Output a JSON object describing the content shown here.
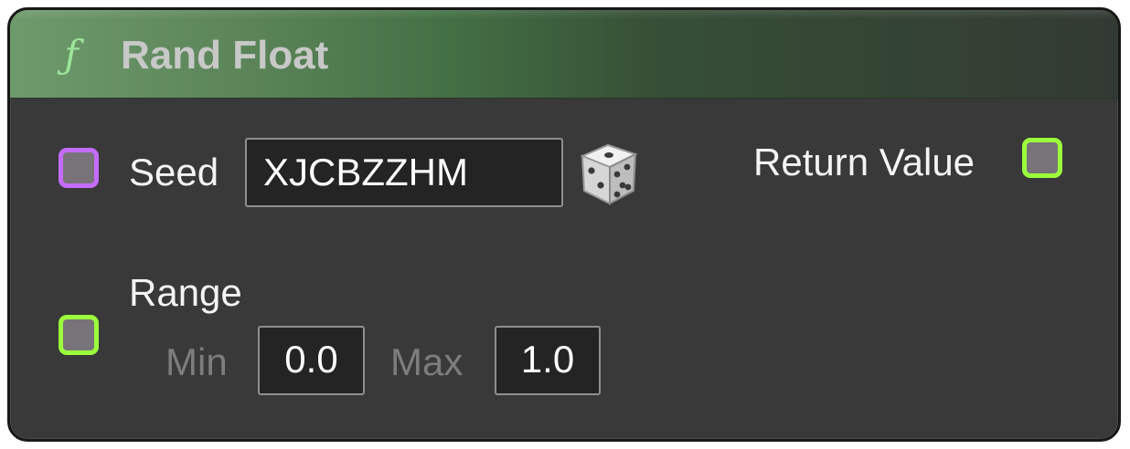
{
  "node": {
    "icon": "function-icon",
    "title": "Rand Float",
    "header_color": "#5a8458"
  },
  "inputs": {
    "seed": {
      "label": "Seed",
      "value": "XJCBZZHM",
      "pin_color": "#c46cff",
      "randomize_icon": "dice-icon"
    },
    "range": {
      "label": "Range",
      "min_label": "Min",
      "min_value": "0.0",
      "max_label": "Max",
      "max_value": "1.0",
      "pin_color": "#9cff3c"
    }
  },
  "outputs": {
    "return_value": {
      "label": "Return Value",
      "pin_color": "#9cff3c"
    }
  }
}
